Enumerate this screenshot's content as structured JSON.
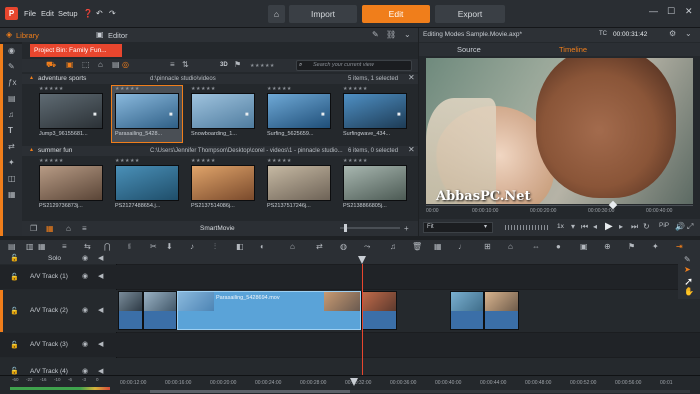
{
  "app": {
    "menu": [
      "File",
      "Edit",
      "Setup"
    ],
    "modes": [
      "Import",
      "Edit",
      "Export"
    ],
    "active_mode": "Edit",
    "accent": "#f07e1b"
  },
  "library": {
    "tabs": [
      "Library",
      "Editor"
    ],
    "bin_tab": "Project Bin: Family Fun...",
    "rating_label": "3D",
    "search_placeholder": "Search your current view",
    "smartmovie": "SmartMovie",
    "groups": [
      {
        "name": "adventure sports",
        "path": "d:\\pinnacle studio\\videos",
        "info": "5 items, 1 selected",
        "items": [
          "Jump3_96155681...",
          "Parasailing_5428...",
          "Snowboarding_1...",
          "Surfing_5625659...",
          "Surfingwave_434..."
        ]
      },
      {
        "name": "summer fun",
        "path": "C:\\Users\\Jennifer Thompson\\Desktop\\corel - videos\\1 - pinnacle studio...",
        "info": "6 items, 0 selected",
        "items": [
          "PS2129736873j...",
          "PS2127488654.j...",
          "PS2137514086j...",
          "PS2137517246j...",
          "PS2138866805j..."
        ]
      }
    ]
  },
  "preview": {
    "title": "Editing Modes Sample.Movie.axp*",
    "tc_label": "TC",
    "timecode": "00:00:31:42",
    "tabs": [
      "Source",
      "Timeline"
    ],
    "active_tab": "Timeline",
    "watermark": "AbbasPC.Net",
    "ruler": [
      "00:00",
      "00:00:10:00",
      "00:00:20:00",
      "00:00:30:00",
      "00:00:40:00"
    ],
    "fit": "Fit",
    "speed": "1x"
  },
  "timeline": {
    "solo": "Solo",
    "tracks": [
      "A/V Track (1)",
      "A/V Track (2)",
      "A/V Track (3)",
      "A/V Track (4)"
    ],
    "clip_label": "Parasailing_5428694.mov",
    "ruler": [
      "00:00:12:00",
      "00:00:16:00",
      "00:00:20:00",
      "00:00:24:00",
      "00:00:28:00",
      "00:00:32:00",
      "00:00:36:00",
      "00:00:40:00",
      "00:00:44:00",
      "00:00:48:00",
      "00:00:52:00",
      "00:00:56:00",
      "00:01"
    ],
    "meter": [
      "-60",
      "-22",
      "-16",
      "-10",
      "-6",
      "-3",
      "0"
    ]
  }
}
